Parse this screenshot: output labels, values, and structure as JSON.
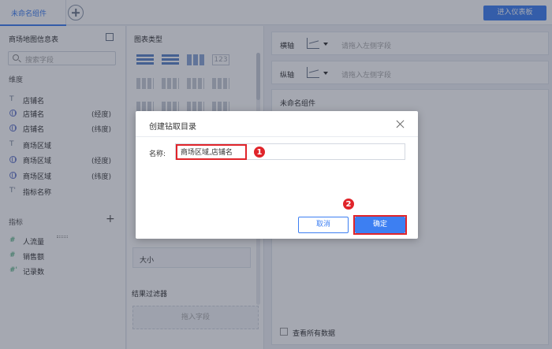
{
  "topbar": {
    "tab_label": "未命名组件",
    "enter_dashboard": "进入仪表板"
  },
  "left_panel": {
    "title": "商场地图信息表",
    "search_placeholder": "搜索字段",
    "dimension_label": "维度",
    "dimensions": [
      {
        "icon": "text-icon",
        "name": "店铺名",
        "sub": ""
      },
      {
        "icon": "globe-icon",
        "name": "店铺名",
        "sub": "(经度)"
      },
      {
        "icon": "globe-icon",
        "name": "店铺名",
        "sub": "(纬度)"
      },
      {
        "icon": "text-icon",
        "name": "商场区域",
        "sub": ""
      },
      {
        "icon": "globe-icon",
        "name": "商场区域",
        "sub": "(经度)"
      },
      {
        "icon": "globe-icon",
        "name": "商场区域",
        "sub": "(纬度)"
      },
      {
        "icon": "text-icon",
        "name": "指标名称",
        "sub": ""
      }
    ],
    "measure_label": "指标",
    "measures": [
      {
        "icon": "#",
        "name": "人流量"
      },
      {
        "icon": "#",
        "name": "销售额"
      },
      {
        "icon": "#",
        "name": "记录数"
      }
    ]
  },
  "mid_panel": {
    "chart_type_title": "图表类型",
    "chart_icon_text": "123",
    "size_label": "大小",
    "result_filter_title": "结果过滤器",
    "drop_placeholder": "拖入字段"
  },
  "right_panel": {
    "x_axis_label": "横轴",
    "x_axis_placeholder": "请拖入左侧字段",
    "y_axis_label": "纵轴",
    "y_axis_placeholder": "请拖入左侧字段",
    "component_title": "未命名组件",
    "view_all_label": "查看所有数据"
  },
  "dialog": {
    "title": "创建钻取目录",
    "name_label": "名称:",
    "name_value": "商场区域,店铺名",
    "cancel_label": "取消",
    "ok_label": "确定",
    "marker_1": "1",
    "marker_2": "2",
    "highlight_color": "#e0242a",
    "accent_color": "#3d7ff2"
  }
}
